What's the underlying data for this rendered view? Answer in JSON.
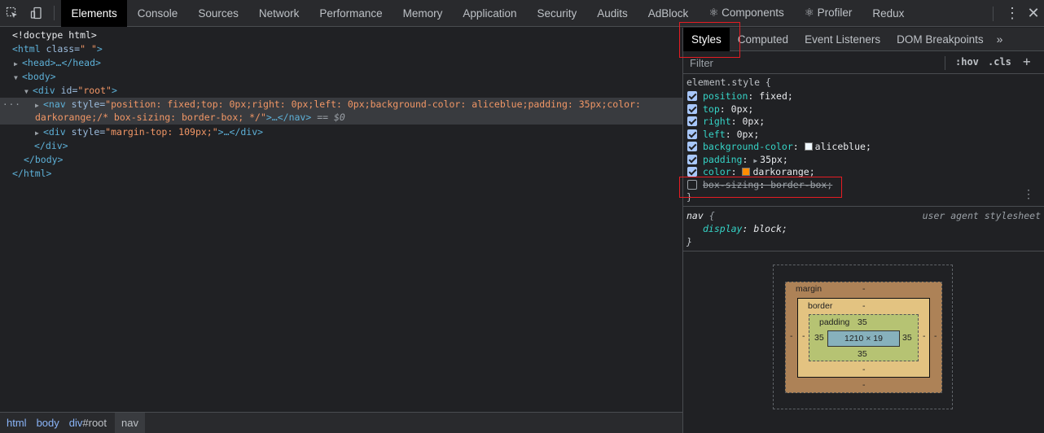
{
  "toolbar": {
    "tabs": [
      "Elements",
      "Console",
      "Sources",
      "Network",
      "Performance",
      "Memory",
      "Application",
      "Security",
      "Audits",
      "AdBlock",
      "⚛ Components",
      "⚛ Profiler",
      "Redux"
    ],
    "active_tab": "Elements",
    "more_icon": "kebab-icon",
    "close_icon": "close-icon"
  },
  "dom": {
    "line0": "<!doctype html>",
    "html_open_tag": "<html",
    "html_class_attr": " class=",
    "html_class_val": "\" \"",
    "html_close_bracket": ">",
    "head": "<head>…</head>",
    "body_open": "<body>",
    "div_root_tag": "<div",
    "div_root_attr": " id=",
    "div_root_val": "\"root\"",
    "div_root_close": ">",
    "nav_tag": "<nav",
    "nav_attr": " style=",
    "nav_val_1": "\"position: fixed;top: 0px;right: 0px;left: 0px;background-color: aliceblue;padding: 35px;color:",
    "nav_val_2": "darkorange;/* box-sizing: border-box; */\"",
    "nav_end": ">…</nav>",
    "nav_eq": " == ",
    "nav_dollar": "$0",
    "div2_tag": "<div",
    "div2_attr": " style=",
    "div2_val": "\"margin-top: 109px;\"",
    "div2_end": ">…</div>",
    "div_close": "</div>",
    "body_close": "</body>",
    "html_close": "</html>",
    "ellipsis": "···"
  },
  "breadcrumb": {
    "items": [
      "html",
      "body",
      "div",
      "#root",
      "nav"
    ]
  },
  "sidebar": {
    "tabs": [
      "Styles",
      "Computed",
      "Event Listeners",
      "DOM Breakpoints"
    ],
    "active_tab": "Styles",
    "more": "»",
    "filter_placeholder": "Filter",
    "hov": ":hov",
    "cls": ".cls",
    "plus": "+"
  },
  "styles": {
    "element_selector": "element.style {",
    "declarations": [
      {
        "prop": "position",
        "value": "fixed;",
        "enabled": true
      },
      {
        "prop": "top",
        "value": "0px;",
        "enabled": true
      },
      {
        "prop": "right",
        "value": "0px;",
        "enabled": true
      },
      {
        "prop": "left",
        "value": "0px;",
        "enabled": true
      },
      {
        "prop": "background-color",
        "value": "aliceblue;",
        "enabled": true,
        "swatch": "#f0f8ff"
      },
      {
        "prop": "padding",
        "value": "35px;",
        "enabled": true,
        "triangle": true
      },
      {
        "prop": "color",
        "value": "darkorange;",
        "enabled": true,
        "swatch": "#ff8c00"
      },
      {
        "prop": "box-sizing",
        "value": "border-box;",
        "enabled": false
      }
    ],
    "close_brace": "}",
    "nav_selector": "nav",
    "nav_open": " {",
    "ua_label": "user agent stylesheet",
    "nav_prop": "display",
    "nav_value": "block;",
    "nav_close": "}"
  },
  "box_model": {
    "margin_label": "margin",
    "margin_top": "-",
    "margin_bottom": "-",
    "margin_left": "-",
    "margin_right": "-",
    "border_label": "border",
    "border_top": "-",
    "border_bottom": "-",
    "border_left": "-",
    "border_right": "-",
    "padding_label": "padding",
    "padding_top": "35",
    "padding_bottom": "35",
    "padding_left": "35",
    "padding_right": "35",
    "content": "1210 × 19"
  },
  "colors": {
    "highlight": "#e51c23",
    "active_tab_bg": "#000000"
  }
}
